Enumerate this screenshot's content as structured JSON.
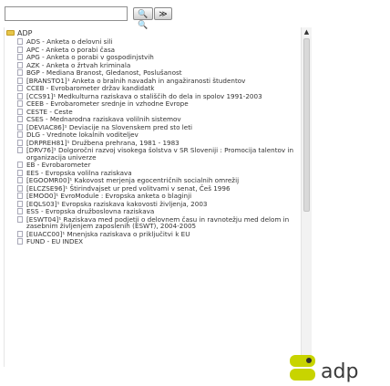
{
  "search": {
    "value": "",
    "placeholder": ""
  },
  "toolbar": {
    "find_label": "🔍🔍",
    "next_label": "≫"
  },
  "tree": {
    "root_label": "ADP",
    "items": [
      "ADS - Anketa o delovni sili",
      "APC - Anketa o porabi časa",
      "APG - Anketa o porabi v gospodinjstvih",
      "AZK - Anketa o žrtvah kriminala",
      "BGP - Mediana Branost, Gledanost, Poslušanost",
      "[BRANSTO1]¹ Anketa o bralnih navadah in angažiranosti študentov",
      "CCEB - Evrobarometer držav kandidatk",
      "[CCS91]¹ Medkulturna raziskava o stališčih do dela in spolov 1991-2003",
      "CEEB - Evrobarometer srednje in vzhodne Evrope",
      "CESTE - Ceste",
      "CSES - Mednarodna raziskava volilnih sistemov",
      "[DEVIAC86]¹ Deviacije na Slovenskem pred sto leti",
      "DLG - Vrednote lokalnih voditeljev",
      "[DRPREH81]¹ Družbena prehrana, 1981 - 1983",
      "[DRV76]¹ Dolgoročni razvoj visokega šolstva v SR Sloveniji : Promocija talentov in organizacija univerze",
      "EB - Evrobarometer",
      "EES - Evropska volilna raziskava",
      "[EGOOMR00]¹ Kakovost merjenja egocentričnih socialnih omrežij",
      "[ELCZSE96]¹ Štirindvajset ur pred volitvami v senat, Češ 1996",
      "[EMOO0]¹ EvroModule : Evropska anketa o blaginji",
      "[EQLS03]¹ Evropska raziskava kakovosti življenja, 2003",
      "ESS - Evropska družboslovna raziskava",
      "[ESWT04]¹ Raziskava med podjetji o delovnem času in ravnotežju med delom in zasebnim življenjem zaposlenih (ESWT), 2004-2005",
      "[EUACC00]¹ Mnenjska raziskava o priključitvi k EU",
      "FUND - EU INDEX"
    ]
  },
  "logo": {
    "text": "adp"
  },
  "colors": {
    "folder": "#e7c64a",
    "logo_primary": "#c8d400",
    "logo_secondary": "#2f2f2f",
    "text": "#333333"
  }
}
